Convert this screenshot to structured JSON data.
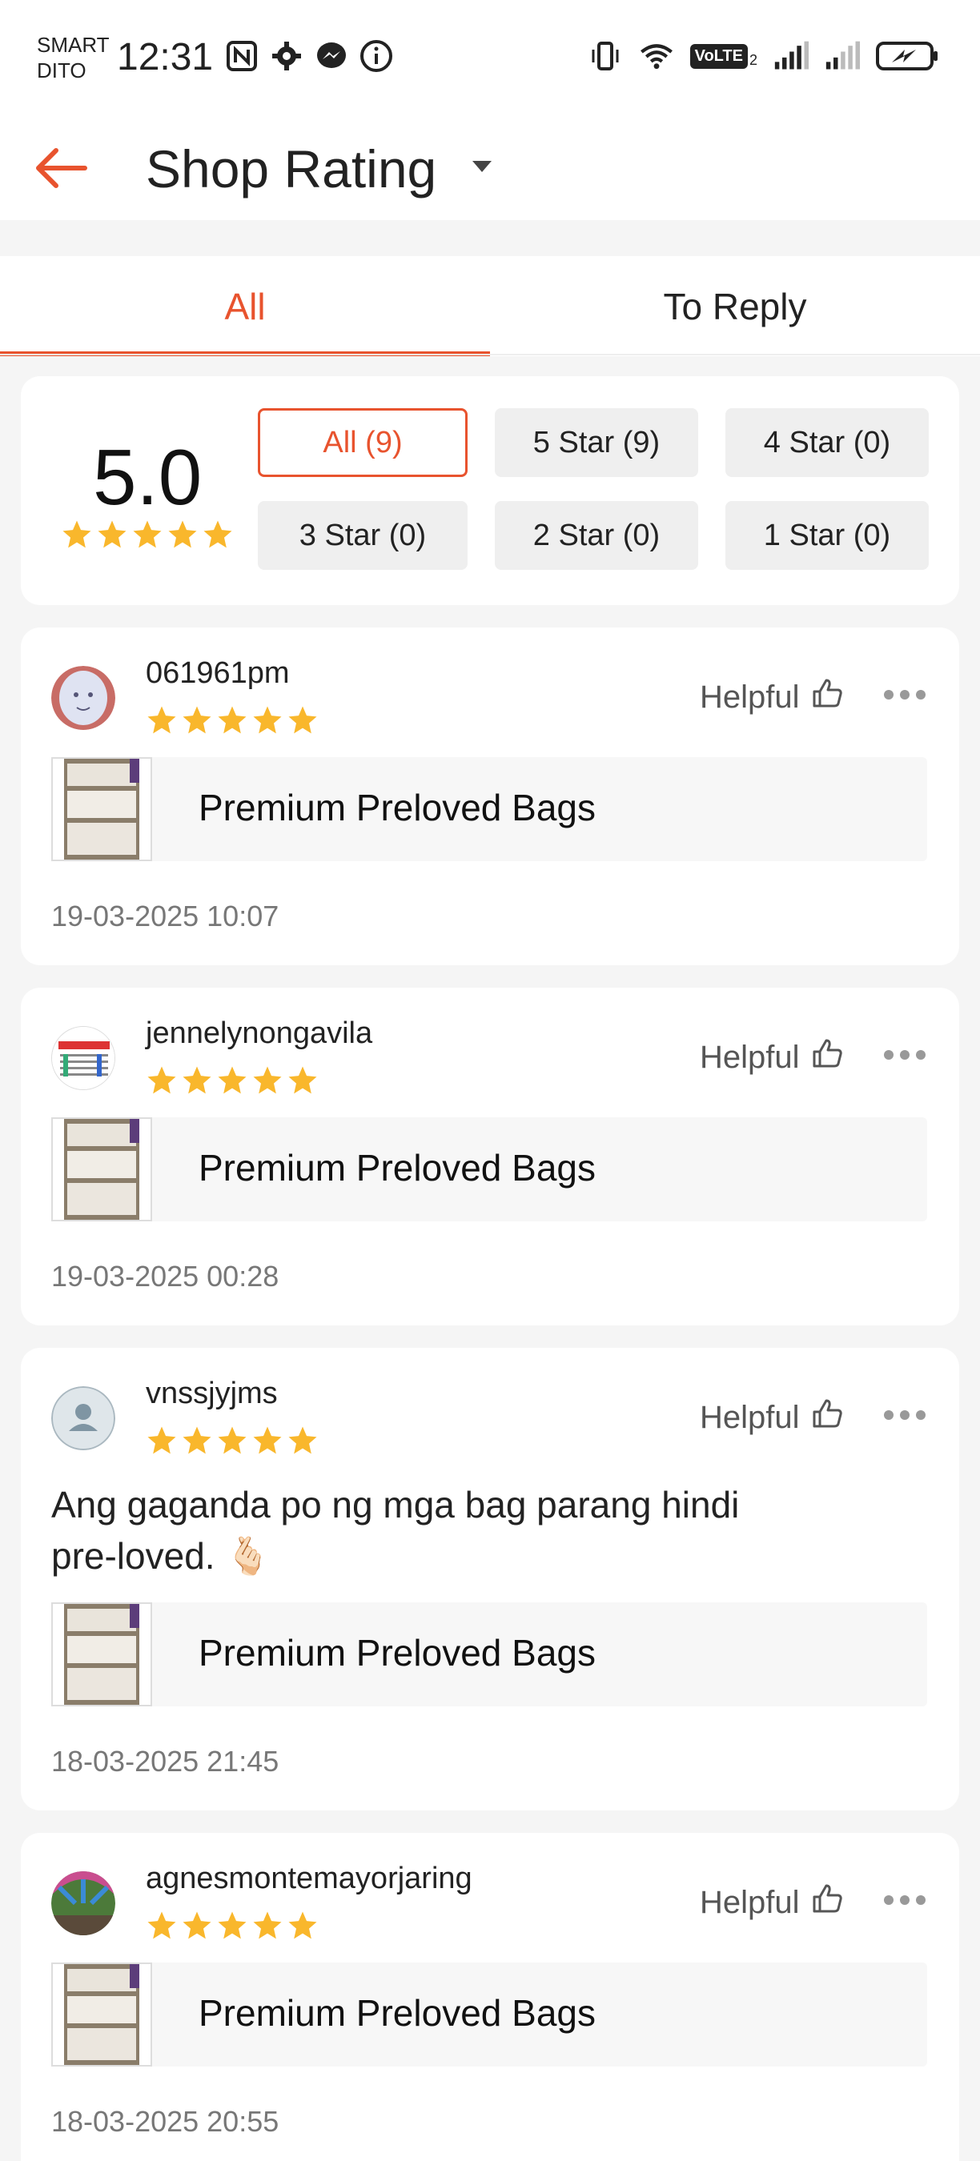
{
  "status_bar": {
    "carrier_line1": "SMART",
    "carrier_line2": "DITO",
    "time": "12:31",
    "volte": "VoLTE",
    "volte_sub": "2"
  },
  "header": {
    "title": "Shop Rating"
  },
  "tabs": [
    {
      "label": "All",
      "active": true
    },
    {
      "label": "To Reply",
      "active": false
    }
  ],
  "summary": {
    "score": "5.0",
    "stars": 5,
    "filters": [
      {
        "label": "All (9)",
        "active": true
      },
      {
        "label": "5 Star (9)",
        "active": false
      },
      {
        "label": "4 Star (0)",
        "active": false
      },
      {
        "label": "3 Star (0)",
        "active": false
      },
      {
        "label": "2 Star (0)",
        "active": false
      },
      {
        "label": "1 Star (0)",
        "active": false
      }
    ]
  },
  "reviews": [
    {
      "username": "061961pm",
      "stars": 5,
      "helpful_label": "Helpful",
      "comment": "",
      "product": "Premium Preloved Bags",
      "date": "19-03-2025 10:07"
    },
    {
      "username": "jennelynongavila",
      "stars": 5,
      "helpful_label": "Helpful",
      "comment": "",
      "product": "Premium Preloved Bags",
      "date": "19-03-2025 00:28"
    },
    {
      "username": "vnssjyjms",
      "stars": 5,
      "helpful_label": "Helpful",
      "comment_line1": "Ang gaganda po ng mga bag parang hindi",
      "comment_line2": "pre-loved. 🫰🏻",
      "product": "Premium Preloved Bags",
      "date": "18-03-2025 21:45"
    },
    {
      "username": "agnesmontemayorjaring",
      "stars": 5,
      "helpful_label": "Helpful",
      "comment": "",
      "product": "Premium Preloved Bags",
      "date": "18-03-2025 20:55"
    }
  ],
  "colors": {
    "accent": "#e8532e",
    "star": "#f9b72c",
    "background": "#f5f5f5"
  }
}
